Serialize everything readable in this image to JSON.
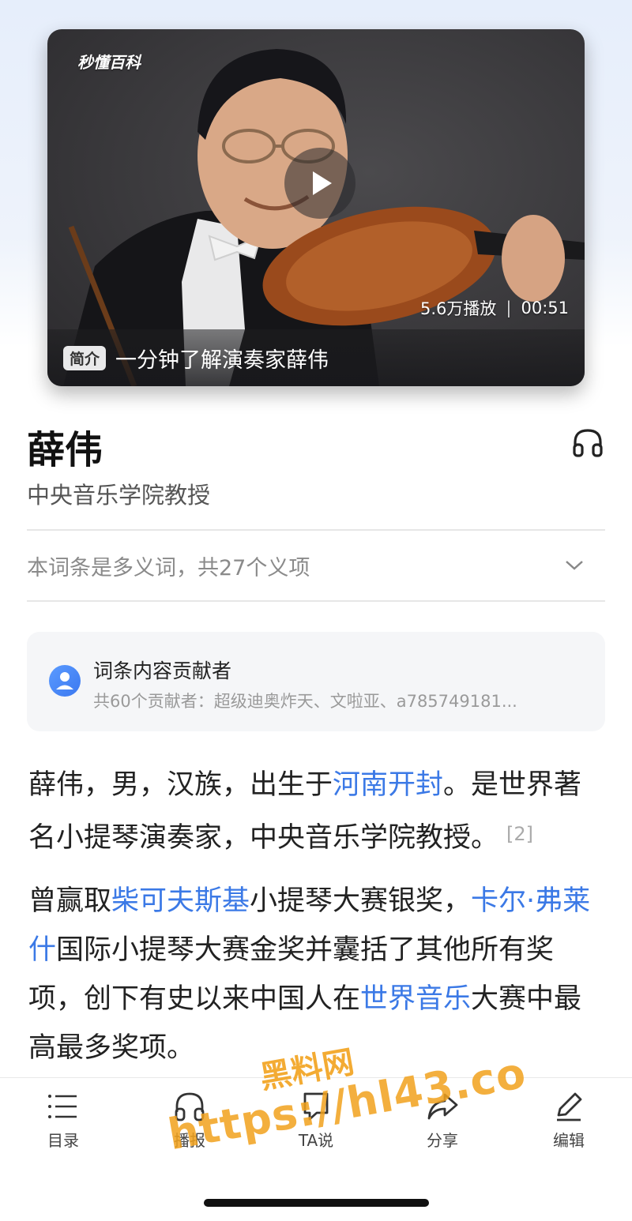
{
  "video": {
    "brand": "秒懂百科",
    "play_count": "5.6万播放",
    "separator": "|",
    "duration": "00:51",
    "tag": "简介",
    "caption": "一分钟了解演奏家薛伟"
  },
  "entry": {
    "title": "薛伟",
    "subtitle": "中央音乐学院教授",
    "polysemy": "本词条是多义词，共27个义项"
  },
  "contributors": {
    "title": "词条内容贡献者",
    "summary": "共60个贡献者：超级迪奥炸天、文啦亚、a785749181..."
  },
  "paragraph1": {
    "t1": "薛伟，男，汉族，出生于",
    "link1": "河南开封",
    "t2": "。是世界著名小提琴演奏家，中央音乐学院教授。",
    "cite": "[2]"
  },
  "paragraph2": {
    "t1": "曾赢取",
    "link1": "柴可夫斯基",
    "t2": "小提琴大赛银奖，",
    "link2": "卡尔·弗莱什",
    "t3": "国际小提琴大赛金奖并囊括了其他所有奖项，创下有史以来中国人在",
    "link3": "世界音乐",
    "t4": "大赛中最高最多奖项。"
  },
  "bottom_nav": [
    {
      "label": "目录",
      "icon": "list-icon"
    },
    {
      "label": "播报",
      "icon": "headphone-icon"
    },
    {
      "label": "TA说",
      "icon": "speech-bubble-icon"
    },
    {
      "label": "分享",
      "icon": "share-icon"
    },
    {
      "label": "编辑",
      "icon": "edit-icon"
    }
  ],
  "watermark": {
    "line1": "黑料网",
    "line2": "https://hl43.co"
  },
  "colors": {
    "link": "#3b79e6",
    "watermark": "#f2a21d",
    "accent_avatar": "#4a89f5"
  }
}
